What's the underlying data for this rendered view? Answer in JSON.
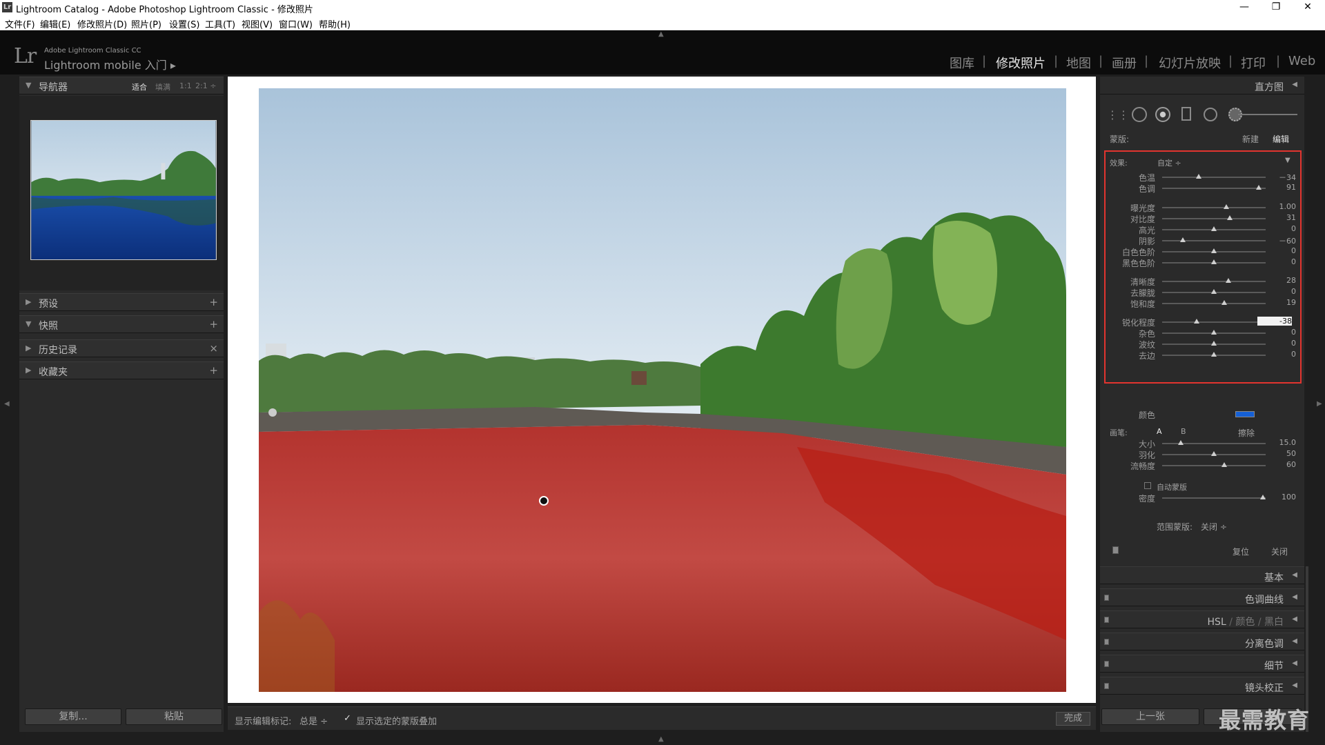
{
  "window": {
    "title": "Lightroom Catalog - Adobe Photoshop Lightroom Classic - 修改照片",
    "icon": "Lr",
    "controls": [
      "—",
      "❐",
      "✕"
    ]
  },
  "menu": [
    "文件(F)",
    "编辑(E)",
    "修改照片(D)",
    "照片(P)",
    "设置(S)",
    "工具(T)",
    "视图(V)",
    "窗口(W)",
    "帮助(H)"
  ],
  "identity": {
    "logo": "Lr",
    "product": "Adobe Lightroom Classic CC",
    "mobile": "Lightroom mobile 入门 ▸"
  },
  "modules": [
    "图库",
    "修改照片",
    "地图",
    "画册",
    "幻灯片放映",
    "打印",
    "Web"
  ],
  "active_module": "修改照片",
  "left": {
    "navigator": {
      "title": "导航器",
      "options": [
        "适合",
        "填满",
        "1:1",
        "2:1 ÷"
      ],
      "active": "适合"
    },
    "panels": [
      {
        "label": "预设",
        "action": "+"
      },
      {
        "label": "快照",
        "action": "+"
      },
      {
        "label": "历史记录",
        "action": "×"
      },
      {
        "label": "收藏夹",
        "action": "+"
      }
    ],
    "copy_btn": "复制...",
    "paste_btn": "粘贴"
  },
  "toolbar": {
    "show_label": "显示编辑标记:",
    "show_value": "总是 ÷",
    "overlay_check": "✓",
    "overlay_label": "显示选定的蒙版叠加",
    "done_btn": "完成"
  },
  "right": {
    "histogram": "直方图",
    "mask_label": "蒙版:",
    "mask_new": "新建",
    "mask_edit": "编辑",
    "effect_label": "效果:",
    "effect_value": "自定 ÷",
    "sliders": [
      {
        "label": "色温",
        "value": "－34",
        "pos": 0.35
      },
      {
        "label": "色调",
        "value": "91",
        "pos": 0.93
      },
      {
        "label": "曝光度",
        "value": "1.00",
        "pos": 0.62
      },
      {
        "label": "对比度",
        "value": "31",
        "pos": 0.65
      },
      {
        "label": "高光",
        "value": "0",
        "pos": 0.5
      },
      {
        "label": "阴影",
        "value": "－60",
        "pos": 0.2
      },
      {
        "label": "白色色阶",
        "value": "0",
        "pos": 0.5
      },
      {
        "label": "黑色色阶",
        "value": "0",
        "pos": 0.5
      },
      {
        "label": "清晰度",
        "value": "28",
        "pos": 0.64
      },
      {
        "label": "去朦胧",
        "value": "0",
        "pos": 0.5
      },
      {
        "label": "饱和度",
        "value": "19",
        "pos": 0.6
      },
      {
        "label": "锐化程度",
        "value": "-38",
        "pos": 0.33
      },
      {
        "label": "杂色",
        "value": "0",
        "pos": 0.5
      },
      {
        "label": "波纹",
        "value": "0",
        "pos": 0.5
      },
      {
        "label": "去边",
        "value": "0",
        "pos": 0.5
      }
    ],
    "color_label": "颜色",
    "mask_color": "#1560d6",
    "brush_label": "画笔:",
    "brush_a": "A",
    "brush_b": "B",
    "brush_erase": "擦除",
    "brush_sliders": [
      {
        "label": "大小",
        "value": "15.0",
        "pos": 0.18
      },
      {
        "label": "羽化",
        "value": "50",
        "pos": 0.5
      },
      {
        "label": "流畅度",
        "value": "60",
        "pos": 0.6
      }
    ],
    "auto_mask": "自动蒙版",
    "density": {
      "label": "密度",
      "value": "100",
      "pos": 0.97
    },
    "range_mask_label": "范围蒙版:",
    "range_mask_value": "关闭 ÷",
    "reset": "复位",
    "close": "关闭",
    "sections": [
      "基本",
      "色调曲线",
      "分离色调",
      "细节",
      "镜头校正"
    ],
    "hsl": {
      "hsl": "HSL",
      "color": "颜色",
      "bw": "黑白",
      "sep": "/"
    },
    "prev_btn": "上一张",
    "watermark": "最需教育"
  }
}
